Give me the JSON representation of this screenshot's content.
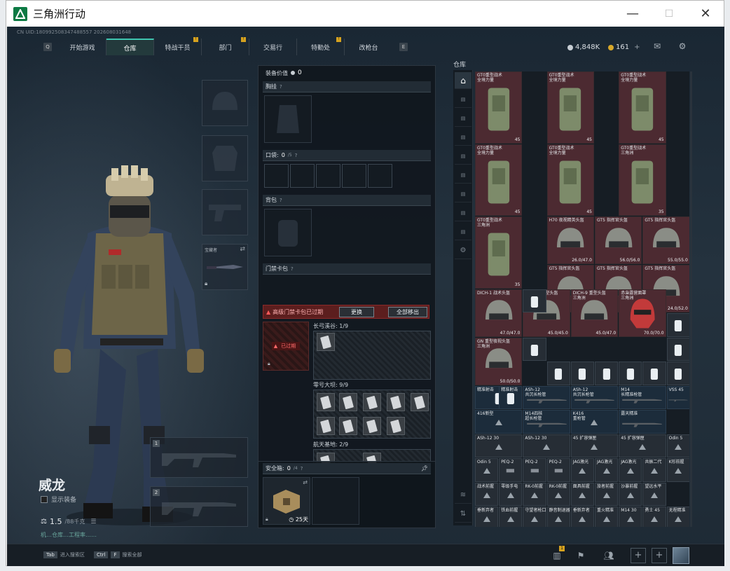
{
  "window": {
    "title": "三角洲行动",
    "minimize": "—",
    "maximize": "☐",
    "close": "✕"
  },
  "uid": "CN UID:18099250834748855​7 202608031648",
  "nav": {
    "q_key": "Q",
    "e_key": "E",
    "tabs": [
      {
        "label": "开始游戏",
        "active": false,
        "badge": false
      },
      {
        "label": "仓库",
        "active": true,
        "badge": false
      },
      {
        "label": "特战干员",
        "active": false,
        "badge": true
      },
      {
        "label": "部门",
        "active": false,
        "badge": true
      },
      {
        "label": "交易行",
        "active": false,
        "badge": false
      },
      {
        "label": "特勤处",
        "active": false,
        "badge": true
      },
      {
        "label": "改枪台",
        "active": false,
        "badge": false
      }
    ]
  },
  "currency": {
    "hafu": "4,848K",
    "coins": "161",
    "plus": "+"
  },
  "operator": {
    "name": "威龙",
    "show_equipment": "显示装备",
    "weight": "1.5",
    "weight_max": "/88千克",
    "hint": "机…仓库…工程率……"
  },
  "slots": {
    "sidearm_label": "宝藏者"
  },
  "equipment": {
    "value_label": "装备价值",
    "value": "0",
    "chest": "胸挂",
    "pocket": "口袋:",
    "pocket_count": "0",
    "pocket_max": "/5",
    "backpack": "背包",
    "keycase": "门禁卡包",
    "alert": "高级门禁卡包已过期",
    "replace": "更换",
    "remove_all": "全部移出",
    "expired": "已过期",
    "sections": [
      {
        "name": "长弓溪谷:",
        "count": "1/9"
      },
      {
        "name": "零号大坝:",
        "count": "9/9"
      },
      {
        "name": "航天基地:",
        "count": "2/9"
      }
    ],
    "safe_box": "安全箱:",
    "safe_count": "0",
    "safe_max": "/4",
    "safe_days": "25天"
  },
  "vault": {
    "title": "仓库",
    "items": [
      {
        "name": "GT0重型战术\n全境力量",
        "dur": "45"
      },
      {
        "name": "GT0重型战术\n全境力量",
        "dur": "45"
      },
      {
        "name": "GT0重型战术\n全境力量",
        "dur": "45"
      },
      {
        "name": "GT0重型战术\n全境力量",
        "dur": "45"
      },
      {
        "name": "GT0重型战术\n全境力量",
        "dur": "45"
      },
      {
        "name": "GT0重型战术\n三角洲",
        "dur": "35"
      },
      {
        "name": "GT0重型战术\n三角洲",
        "dur": "35"
      },
      {
        "name": "H70 夜视精英头盔",
        "dur": "26.0/47.0"
      },
      {
        "name": "GT5 指挥官头盔",
        "dur": "56.0/56.0"
      },
      {
        "name": "GT5 指挥官头盔",
        "dur": "55.0/55.0"
      },
      {
        "name": "GT5 指挥官头盔",
        "dur": "55.0/55.0"
      },
      {
        "name": "GT5 指挥官头盔",
        "dur": "54.0/54.0"
      },
      {
        "name": "GT5 指挥官头盔",
        "dur": "24.0/52.0"
      },
      {
        "name": "DICH-1 战术头盔",
        "dur": "47.0/47.0"
      },
      {
        "name": "DICH-9 重型头盔\n三角洲",
        "dur": "45.0/45.0"
      },
      {
        "name": "DICH-9 重型头盔\n三角洲",
        "dur": "45.0/47.0"
      },
      {
        "name": "赤枭露营面罩\n三角洲",
        "dur": "70.0/70.0"
      },
      {
        "name": "GN 重型夜视头盔\n三角洲",
        "dur": "50.0/50.0"
      },
      {
        "name": "精准射击",
        "dur": ""
      },
      {
        "name": "精准射击",
        "dur": ""
      },
      {
        "name": "ASh-12\n共沉长枪管",
        "dur": ""
      },
      {
        "name": "ASh-12\n共沉长枪管",
        "dur": ""
      },
      {
        "name": "M14\n长精准枪管",
        "dur": ""
      },
      {
        "name": "VSS 45",
        "dur": ""
      },
      {
        "name": "416新型",
        "dur": ""
      },
      {
        "name": "M14四核\n超长枪管",
        "dur": ""
      },
      {
        "name": "K416\n重枪管",
        "dur": ""
      },
      {
        "name": "露天精准",
        "dur": ""
      },
      {
        "name": "ASh-12 30",
        "dur": ""
      },
      {
        "name": "ASh-12 30",
        "dur": ""
      },
      {
        "name": "45 扩容弹匣",
        "dur": ""
      },
      {
        "name": "45 扩容弹匣",
        "dur": ""
      },
      {
        "name": "Odin 5",
        "dur": ""
      },
      {
        "name": "Odin 5",
        "dur": ""
      },
      {
        "name": "PEQ-2",
        "dur": ""
      },
      {
        "name": "PEQ-2",
        "dur": ""
      },
      {
        "name": "PEQ-2",
        "dur": ""
      },
      {
        "name": "JAG激光",
        "dur": ""
      },
      {
        "name": "JAG激光",
        "dur": ""
      },
      {
        "name": "JAG激光",
        "dur": ""
      },
      {
        "name": "共振二代",
        "dur": ""
      },
      {
        "name": "K形前握",
        "dur": ""
      },
      {
        "name": "战术前握",
        "dur": ""
      },
      {
        "name": "零级手电",
        "dur": ""
      },
      {
        "name": "RK-0前握",
        "dur": ""
      },
      {
        "name": "RK-0前握",
        "dur": ""
      },
      {
        "name": "面具前握",
        "dur": ""
      },
      {
        "name": "旅者前握",
        "dur": ""
      },
      {
        "name": "沙暴前握",
        "dur": ""
      },
      {
        "name": "望远水平",
        "dur": ""
      },
      {
        "name": "垂新弃者",
        "dur": ""
      },
      {
        "name": "铁血前握",
        "dur": ""
      },
      {
        "name": "守望者枪口",
        "dur": ""
      },
      {
        "name": "静音制退器",
        "dur": ""
      },
      {
        "name": "垂新弃者",
        "dur": ""
      },
      {
        "name": "重火精准",
        "dur": ""
      },
      {
        "name": "M14 30",
        "dur": ""
      },
      {
        "name": "勇士 45",
        "dur": ""
      },
      {
        "name": "无程精准",
        "dur": ""
      }
    ]
  },
  "bottom": {
    "tab_key": "Tab",
    "tab_label": "进入搜索区",
    "ctrl_key": "Ctrl",
    "f_key": "F",
    "ctrl_label": "搜索全部",
    "badge": "1"
  }
}
